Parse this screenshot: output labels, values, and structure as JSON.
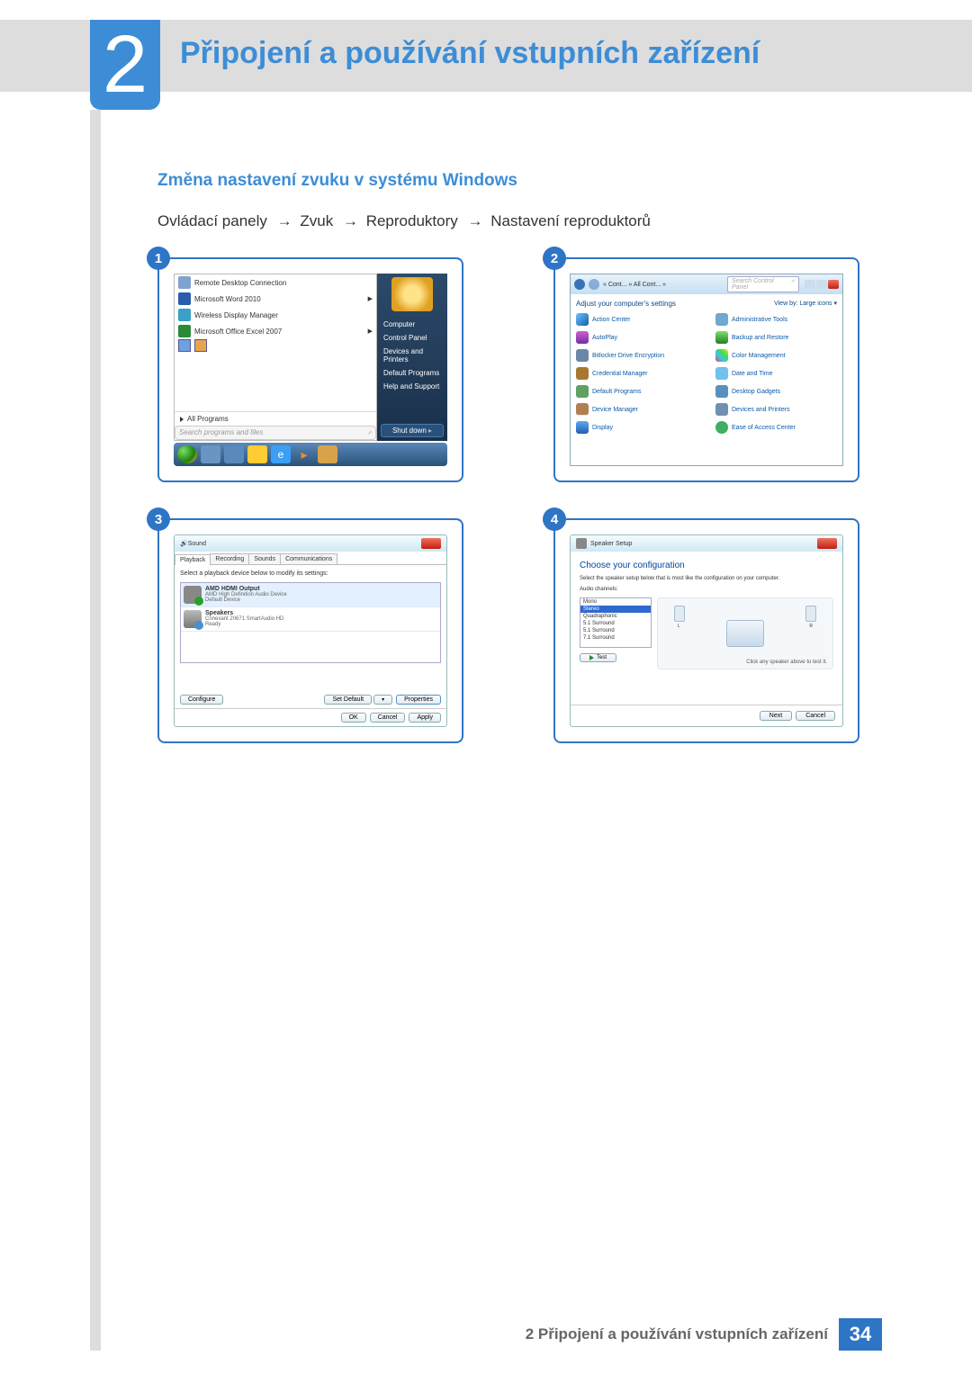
{
  "chapter": {
    "number": "2",
    "title": "Připojení a používání vstupních zařízení"
  },
  "section_heading": "Změna nastavení zvuku v systému Windows",
  "breadcrumb": [
    "Ovládací panely",
    "Zvuk",
    "Reproduktory",
    "Nastavení reproduktorů"
  ],
  "arrow": "→",
  "circles": [
    "1",
    "2",
    "3",
    "4"
  ],
  "shot1": {
    "items": [
      {
        "label": "Remote Desktop Connection",
        "sub": false
      },
      {
        "label": "Microsoft Word 2010",
        "sub": true
      },
      {
        "label": "Wireless Display Manager",
        "sub": false
      },
      {
        "label": "Microsoft Office Excel 2007",
        "sub": true
      }
    ],
    "all_programs": "All Programs",
    "search_placeholder": "Search programs and files",
    "right": [
      "Computer",
      "Control Panel",
      "Devices and Printers",
      "Default Programs",
      "Help and Support"
    ],
    "shut_down": "Shut down"
  },
  "shot2": {
    "crumb": "« Cont... » All Cont... »",
    "search_placeholder": "Search Control Panel",
    "adjust": "Adjust your computer's settings",
    "view": "View by:  Large icons ▾",
    "left_items": [
      "Action Center",
      "AutoPlay",
      "Bitlocker Drive Encryption",
      "Credential Manager",
      "Default Programs",
      "Device Manager",
      "Display"
    ],
    "right_items": [
      "Administrative Tools",
      "Backup and Restore",
      "Color Management",
      "Date and Time",
      "Desktop Gadgets",
      "Devices and Printers",
      "Ease of Access Center"
    ]
  },
  "shot3": {
    "title": "Sound",
    "tabs": [
      "Playback",
      "Recording",
      "Sounds",
      "Communications"
    ],
    "label": "Select a playback device below to modify its settings:",
    "devices": [
      {
        "name": "AMD HDMI Output",
        "sub": "AMD High Definition Audio Device",
        "state": "Default Device"
      },
      {
        "name": "Speakers",
        "sub": "Conexant 20671 SmartAudio HD",
        "state": "Ready"
      }
    ],
    "configure": "Configure",
    "set_default": "Set Default",
    "properties": "Properties",
    "ok": "OK",
    "cancel": "Cancel",
    "apply": "Apply"
  },
  "shot4": {
    "title": "Speaker Setup",
    "heading": "Choose your configuration",
    "text": "Select the speaker setup below that is most like the configuration on your computer.",
    "audio_channels_label": "Audio channels:",
    "options": [
      "Mono",
      "Stereo",
      "Quadraphonic",
      "5.1 Surround",
      "5.1 Surround",
      "7.1 Surround"
    ],
    "test": "Test",
    "note": "Click any speaker above to test it.",
    "next": "Next",
    "cancel": "Cancel",
    "spk_l": "L",
    "spk_r": "R"
  },
  "footer": {
    "text": "2 Připojení a používání vstupních zařízení",
    "page": "34"
  }
}
